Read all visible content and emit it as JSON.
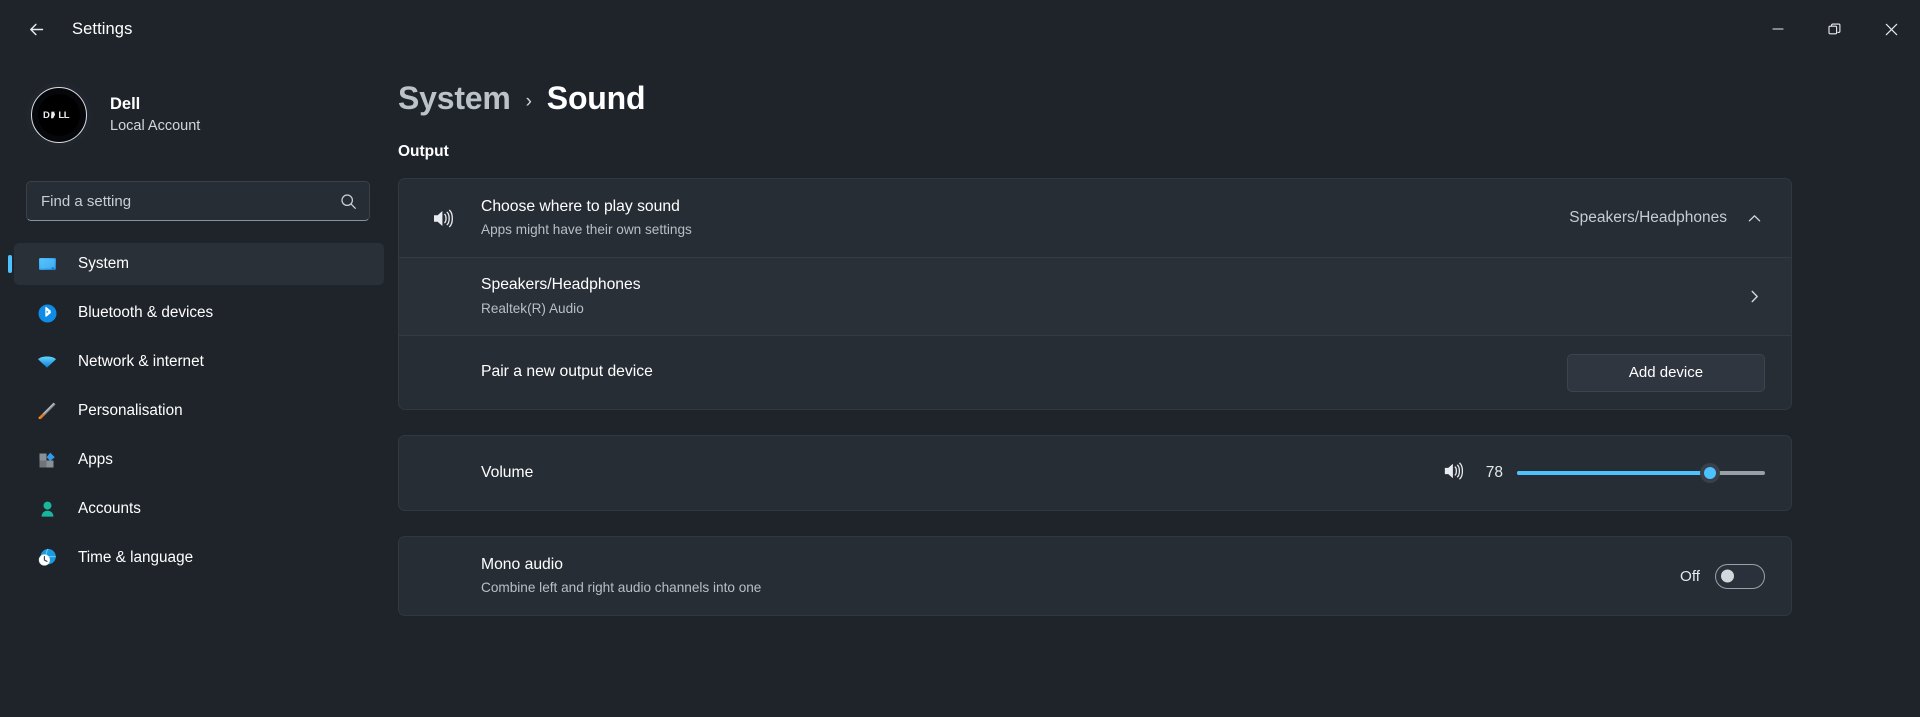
{
  "titlebar": {
    "back_icon": "back-arrow-icon",
    "title": "Settings",
    "minimize_icon": "minimize-icon",
    "restore_icon": "restore-icon",
    "close_icon": "close-icon"
  },
  "sidebar": {
    "account": {
      "avatar_icon": "dell-logo-avatar",
      "name": "Dell",
      "type": "Local Account"
    },
    "search": {
      "placeholder": "Find a setting",
      "value": "",
      "icon": "search-icon"
    },
    "items": [
      {
        "label": "System",
        "icon": "monitor-icon",
        "active": true
      },
      {
        "label": "Bluetooth & devices",
        "icon": "bluetooth-icon",
        "active": false
      },
      {
        "label": "Network & internet",
        "icon": "wifi-icon",
        "active": false
      },
      {
        "label": "Personalisation",
        "icon": "paintbrush-icon",
        "active": false
      },
      {
        "label": "Apps",
        "icon": "apps-icon",
        "active": false
      },
      {
        "label": "Accounts",
        "icon": "person-icon",
        "active": false
      },
      {
        "label": "Time & language",
        "icon": "clock-globe-icon",
        "active": false
      }
    ]
  },
  "main": {
    "breadcrumb": {
      "parent": "System",
      "separator": "›",
      "current": "Sound"
    },
    "output_section_label": "Output",
    "choose_output": {
      "icon": "speaker-icon",
      "title": "Choose where to play sound",
      "subtitle": "Apps might have their own settings",
      "value": "Speakers/Headphones",
      "expand_icon": "chevron-up-icon"
    },
    "device_row": {
      "title": "Speakers/Headphones",
      "subtitle": "Realtek(R) Audio",
      "chevron_icon": "chevron-right-icon"
    },
    "pair_row": {
      "title": "Pair a new output device",
      "button_label": "Add device"
    },
    "volume_row": {
      "title": "Volume",
      "icon": "speaker-icon",
      "value": "78",
      "percent": 78
    },
    "mono_row": {
      "title": "Mono audio",
      "subtitle": "Combine left and right audio channels into one",
      "state_label": "Off",
      "enabled": false
    }
  },
  "colors": {
    "accent": "#4cc2ff",
    "window_bg": "#1f242b",
    "card_bg": "#272d35",
    "card_sub_bg": "#2a3038"
  }
}
